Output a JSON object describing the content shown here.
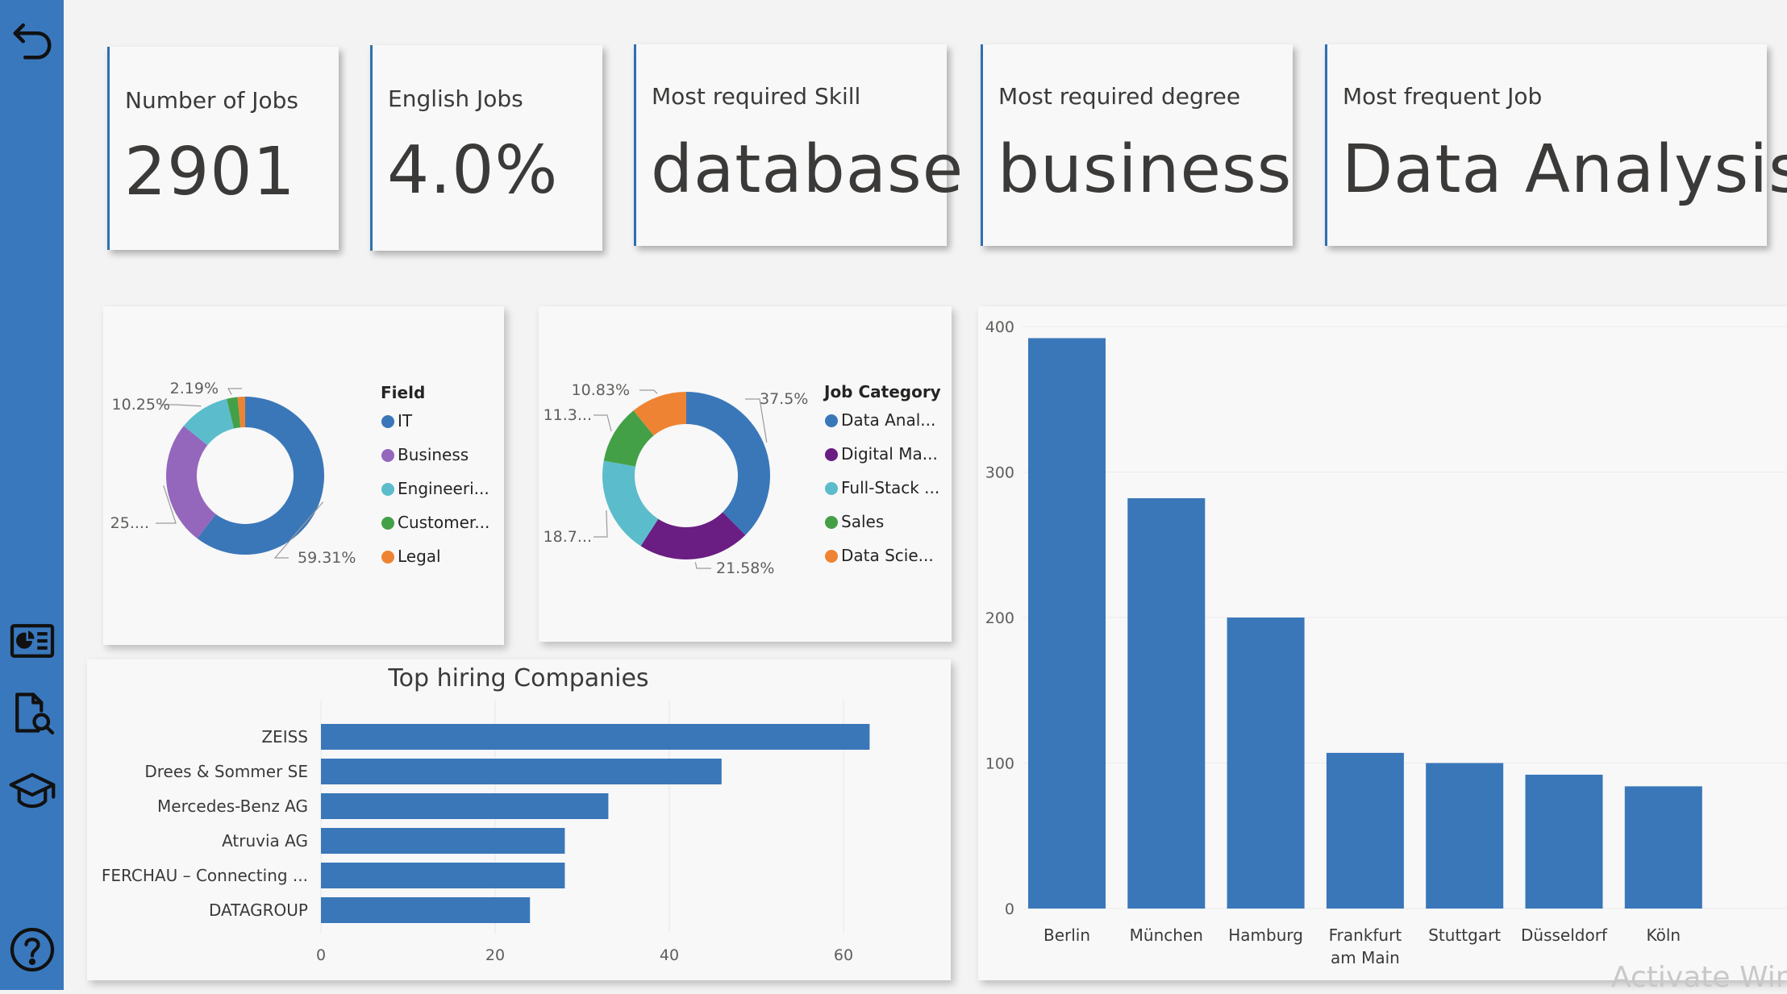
{
  "sidebar": {
    "icons": [
      "back-arrow-icon",
      "dashboard-report-icon",
      "document-search-icon",
      "graduation-cap-icon",
      "help-icon"
    ]
  },
  "kpis": [
    {
      "label": "Number of Jobs",
      "value": "2901"
    },
    {
      "label": "English Jobs",
      "value": "4.0%"
    },
    {
      "label": "Most required Skill",
      "value": "database"
    },
    {
      "label": "Most required degree",
      "value": "business"
    },
    {
      "label": "Most frequent Job",
      "value": "Data Analysis"
    }
  ],
  "chart_data": [
    {
      "type": "pie",
      "variant": "donut",
      "legend_title": "Field",
      "legend_position": "right",
      "categories": [
        "IT",
        "Business",
        "Engineeri...",
        "Customer...",
        "Legal"
      ],
      "values": [
        59.31,
        25.0,
        10.25,
        2.19,
        1.5
      ],
      "colors": [
        "#3a77b9",
        "#9467bd",
        "#5bbccc",
        "#44a047",
        "#ee8433"
      ],
      "data_labels": [
        "59.31%",
        "25....",
        "10.25%",
        "2.19%"
      ]
    },
    {
      "type": "pie",
      "variant": "donut",
      "legend_title": "Job Category",
      "legend_position": "right",
      "categories": [
        "Data Anal...",
        "Digital Ma...",
        "Full-Stack ...",
        "Sales",
        "Data Scie..."
      ],
      "values": [
        37.5,
        21.58,
        18.7,
        11.3,
        10.83
      ],
      "colors": [
        "#3a77b9",
        "#6a1d82",
        "#5bbccc",
        "#44a047",
        "#ee8433"
      ],
      "data_labels": [
        "37.5%",
        "21.58%",
        "18.7...",
        "11.3...",
        "10.83%"
      ]
    },
    {
      "type": "bar",
      "orientation": "horizontal",
      "title": "Top hiring Companies",
      "categories": [
        "ZEISS",
        "Drees & Sommer SE",
        "Mercedes-Benz AG",
        "Atruvia AG",
        "FERCHAU – Connecting ...",
        "DATAGROUP"
      ],
      "values": [
        63,
        46,
        33,
        28,
        28,
        24
      ],
      "xlim": [
        0,
        70
      ],
      "xticks": [
        "0",
        "20",
        "40",
        "60"
      ],
      "grid": true,
      "color": "#3a77b9"
    },
    {
      "type": "bar",
      "orientation": "vertical",
      "categories": [
        "Berlin",
        "München",
        "Hamburg",
        "Frankfurt am Main",
        "Stuttgart",
        "Düsseldorf",
        "Köln"
      ],
      "category_lines": [
        [
          "Berlin"
        ],
        [
          "München"
        ],
        [
          "Hamburg"
        ],
        [
          "Frankfurt",
          "am Main"
        ],
        [
          "Stuttgart"
        ],
        [
          "Düsseldorf"
        ],
        [
          "Köln"
        ]
      ],
      "values": [
        392,
        282,
        200,
        107,
        100,
        92,
        84
      ],
      "ylim": [
        0,
        400
      ],
      "yticks": [
        "0",
        "100",
        "200",
        "300",
        "400"
      ],
      "grid": true,
      "color": "#3a77b9"
    }
  ],
  "watermark": "Activate Win"
}
